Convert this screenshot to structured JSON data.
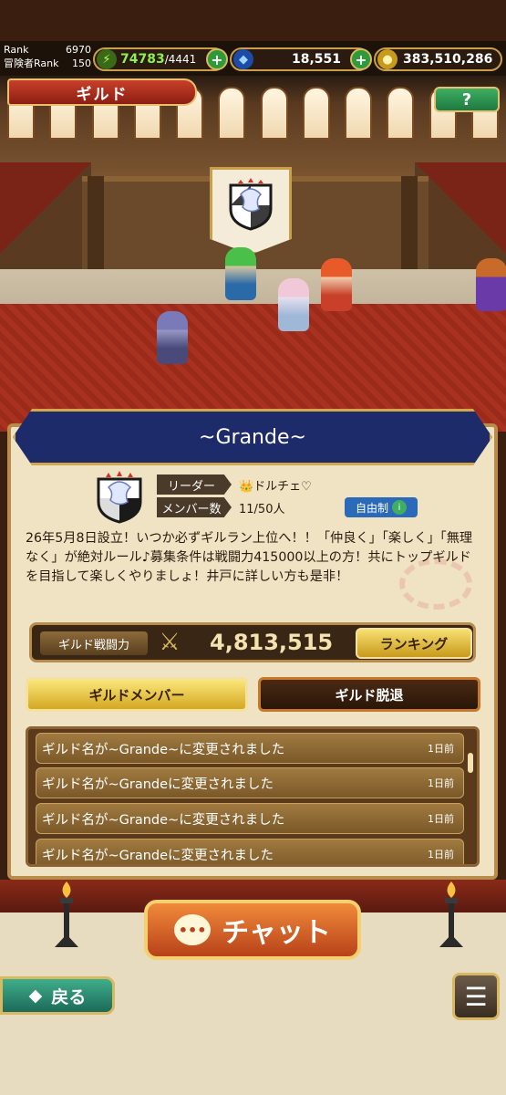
{
  "status": {
    "rank_label": "Rank",
    "rank_value": "6970",
    "adv_rank_label": "冒険者Rank",
    "adv_rank_value": "150",
    "stamina_current": "74783",
    "stamina_max": "/4441",
    "gems": "18,551",
    "gold": "383,510,286"
  },
  "header": {
    "title": "ギルド",
    "help_label": "?"
  },
  "guild": {
    "name": "~Grande~",
    "leader_label": "リーダー",
    "leader_value": "👑ドルチェ♡",
    "members_label": "メンバー数",
    "members_value": "11/50人",
    "join_policy": "自由制",
    "description": "26年5月8日設立！いつか必ずギルラン上位へ！！「仲良く」「楽しく」「無理なく」が絶対ルール♪募集条件は戦闘力415000以上の方！共にトップギルドを目指して楽しくやりましょ！井戸に詳しい方も是非！",
    "power_label": "ギルド戦闘力",
    "power_value": "4,813,515",
    "ranking_label": "ランキング"
  },
  "tabs": {
    "members": "ギルドメンバー",
    "leave": "ギルド脱退"
  },
  "log": [
    {
      "text": "ギルド名が~Grande~に変更されました",
      "time": "1日前"
    },
    {
      "text": "ギルド名が~Grandeに変更されました",
      "time": "1日前"
    },
    {
      "text": "ギルド名が~Grande~に変更されました",
      "time": "1日前"
    },
    {
      "text": "ギルド名が~Grandeに変更されました",
      "time": "1日前"
    }
  ],
  "footer": {
    "chat_label": "チャット",
    "back_label": "戻る"
  },
  "colors": {
    "ribbon": "#1e2b6a",
    "parchment": "#efe3c4",
    "gold_trim": "#d4a848",
    "chat_button": "#f08a3a"
  }
}
